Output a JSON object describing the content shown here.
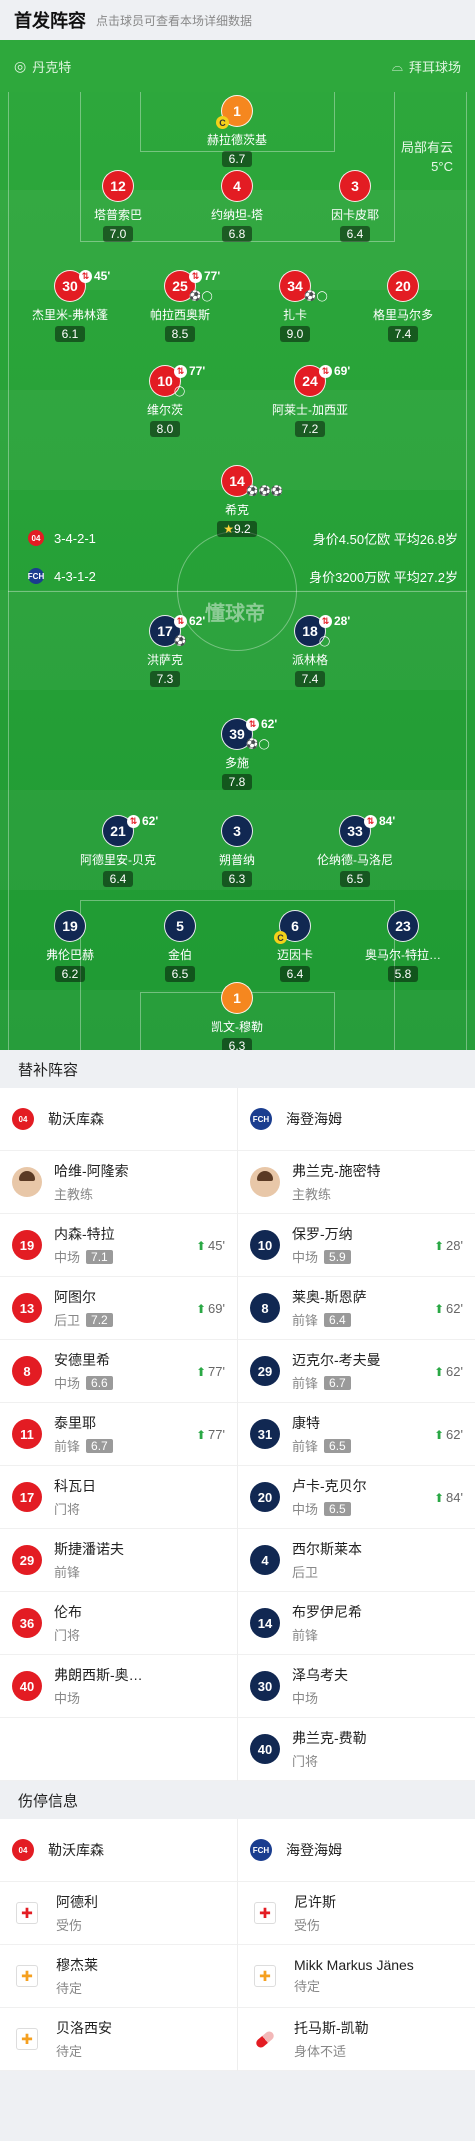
{
  "header": {
    "title": "首发阵容",
    "hint": "点击球员可查看本场详细数据"
  },
  "venue": {
    "home_coach_label": "丹克特",
    "stadium": "拜耳球场"
  },
  "weather": {
    "condition": "局部有云",
    "temp": "5°C"
  },
  "watermark": "懂球帝",
  "home_formation": {
    "shape": "3-4-2-1",
    "value": "身价4.50亿欧 平均26.8岁"
  },
  "away_formation": {
    "shape": "4-3-1-2",
    "value": "身价3200万欧 平均27.2岁"
  },
  "home_players": [
    {
      "num": "1",
      "name": "赫拉德茨基",
      "rating": "6.7",
      "captain": true
    },
    {
      "num": "12",
      "name": "塔普索巴",
      "rating": "7.0"
    },
    {
      "num": "4",
      "name": "约纳坦-塔",
      "rating": "6.8"
    },
    {
      "num": "3",
      "name": "因卡皮耶",
      "rating": "6.4"
    },
    {
      "num": "30",
      "name": "杰里米-弗林蓬",
      "rating": "6.1",
      "sub": "45'"
    },
    {
      "num": "25",
      "name": "帕拉西奥斯",
      "rating": "8.5",
      "sub": "77'",
      "goals": "⚽◯"
    },
    {
      "num": "34",
      "name": "扎卡",
      "rating": "9.0",
      "goals": "⚽◯"
    },
    {
      "num": "20",
      "name": "格里马尔多",
      "rating": "7.4"
    },
    {
      "num": "10",
      "name": "维尔茨",
      "rating": "8.0",
      "sub": "77'",
      "goals": "◯"
    },
    {
      "num": "24",
      "name": "阿莱士-加西亚",
      "rating": "7.2",
      "sub": "69'"
    },
    {
      "num": "14",
      "name": "希克",
      "rating": "9.2",
      "goals": "⚽⚽⚽",
      "star": true
    }
  ],
  "away_players": [
    {
      "num": "17",
      "name": "洪萨克",
      "rating": "7.3",
      "sub": "62'",
      "goals": "⚽"
    },
    {
      "num": "18",
      "name": "派林格",
      "rating": "7.4",
      "sub": "28'",
      "goals": "◯"
    },
    {
      "num": "39",
      "name": "多施",
      "rating": "7.8",
      "sub": "62'",
      "goals": "⚽◯"
    },
    {
      "num": "21",
      "name": "阿德里安-贝克",
      "rating": "6.4",
      "sub": "62'"
    },
    {
      "num": "3",
      "name": "朔普纳",
      "rating": "6.3"
    },
    {
      "num": "33",
      "name": "伦纳德-马洛尼",
      "rating": "6.5",
      "sub": "84'"
    },
    {
      "num": "19",
      "name": "弗伦巴赫",
      "rating": "6.2"
    },
    {
      "num": "5",
      "name": "金伯",
      "rating": "6.5"
    },
    {
      "num": "6",
      "name": "迈因卡",
      "rating": "6.4",
      "captain": true
    },
    {
      "num": "23",
      "name": "奥马尔-特拉…",
      "rating": "5.8"
    },
    {
      "num": "1",
      "name": "凯文-穆勒",
      "rating": "6.3"
    }
  ],
  "subs_title": "替补阵容",
  "home_team": "勒沃库森",
  "away_team": "海登海姆",
  "home_crest": "04",
  "away_crest": "FCH",
  "home_coach": {
    "name": "哈维-阿隆索",
    "role": "主教练"
  },
  "away_coach": {
    "name": "弗兰克-施密特",
    "role": "主教练"
  },
  "home_subs": [
    {
      "num": "19",
      "name": "内森-特拉",
      "pos": "中场",
      "rating": "7.1",
      "time": "45'"
    },
    {
      "num": "13",
      "name": "阿图尔",
      "pos": "后卫",
      "rating": "7.2",
      "time": "69'"
    },
    {
      "num": "8",
      "name": "安德里希",
      "pos": "中场",
      "rating": "6.6",
      "time": "77'"
    },
    {
      "num": "11",
      "name": "泰里耶",
      "pos": "前锋",
      "rating": "6.7",
      "time": "77'"
    },
    {
      "num": "17",
      "name": "科瓦日",
      "pos": "门将"
    },
    {
      "num": "29",
      "name": "斯捷潘诺夫",
      "pos": "前锋"
    },
    {
      "num": "36",
      "name": "伦布",
      "pos": "门将"
    },
    {
      "num": "40",
      "name": "弗朗西斯-奥…",
      "pos": "中场"
    }
  ],
  "away_subs": [
    {
      "num": "10",
      "name": "保罗-万纳",
      "pos": "中场",
      "rating": "5.9",
      "time": "28'"
    },
    {
      "num": "8",
      "name": "莱奥-斯恩萨",
      "pos": "前锋",
      "rating": "6.4",
      "time": "62'"
    },
    {
      "num": "29",
      "name": "迈克尔-考夫曼",
      "pos": "前锋",
      "rating": "6.7",
      "time": "62'"
    },
    {
      "num": "31",
      "name": "康特",
      "pos": "前锋",
      "rating": "6.5",
      "time": "62'"
    },
    {
      "num": "20",
      "name": "卢卡-克贝尔",
      "pos": "中场",
      "rating": "6.5",
      "time": "84'"
    },
    {
      "num": "4",
      "name": "西尔斯莱本",
      "pos": "后卫"
    },
    {
      "num": "14",
      "name": "布罗伊尼希",
      "pos": "前锋"
    },
    {
      "num": "30",
      "name": "泽乌考夫",
      "pos": "中场"
    },
    {
      "num": "40",
      "name": "弗兰克-费勒",
      "pos": "门将"
    }
  ],
  "injury_title": "伤停信息",
  "home_injuries": [
    {
      "name": "阿德利",
      "status": "受伤",
      "icon": "injury-icon"
    },
    {
      "name": "穆杰莱",
      "status": "待定",
      "icon": "doubtful-icon"
    },
    {
      "name": "贝洛西安",
      "status": "待定",
      "icon": "doubtful-icon"
    }
  ],
  "away_injuries": [
    {
      "name": "尼许斯",
      "status": "受伤",
      "icon": "injury-icon"
    },
    {
      "name": "Mikk Markus Jänes",
      "status": "待定",
      "icon": "doubtful-icon"
    },
    {
      "name": "托马斯-凯勒",
      "status": "身体不适",
      "icon": "illness-icon"
    }
  ]
}
